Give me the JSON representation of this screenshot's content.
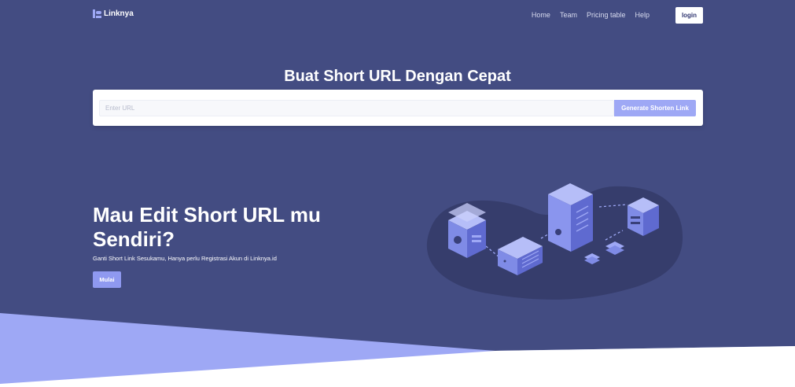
{
  "navbar": {
    "brand": "Linknya",
    "links": [
      "Home",
      "Team",
      "Pricing table",
      "Help"
    ],
    "login_label": "login"
  },
  "hero": {
    "title": "Buat Short URL Dengan Cepat",
    "input_placeholder": "Enter URL",
    "input_value": "",
    "generate_label": "Generate Shorten Link"
  },
  "promo": {
    "title": "Mau Edit Short URL mu Sendiri?",
    "description": "Ganti Short Link Sesukamu, Hanya perlu Registrasi Akun di Linknya.id",
    "button_label": "Mulai",
    "illustration_icon": "server-network-illustration"
  },
  "colors": {
    "background": "#434c82",
    "accent": "#9ea8f5",
    "white": "#ffffff"
  }
}
